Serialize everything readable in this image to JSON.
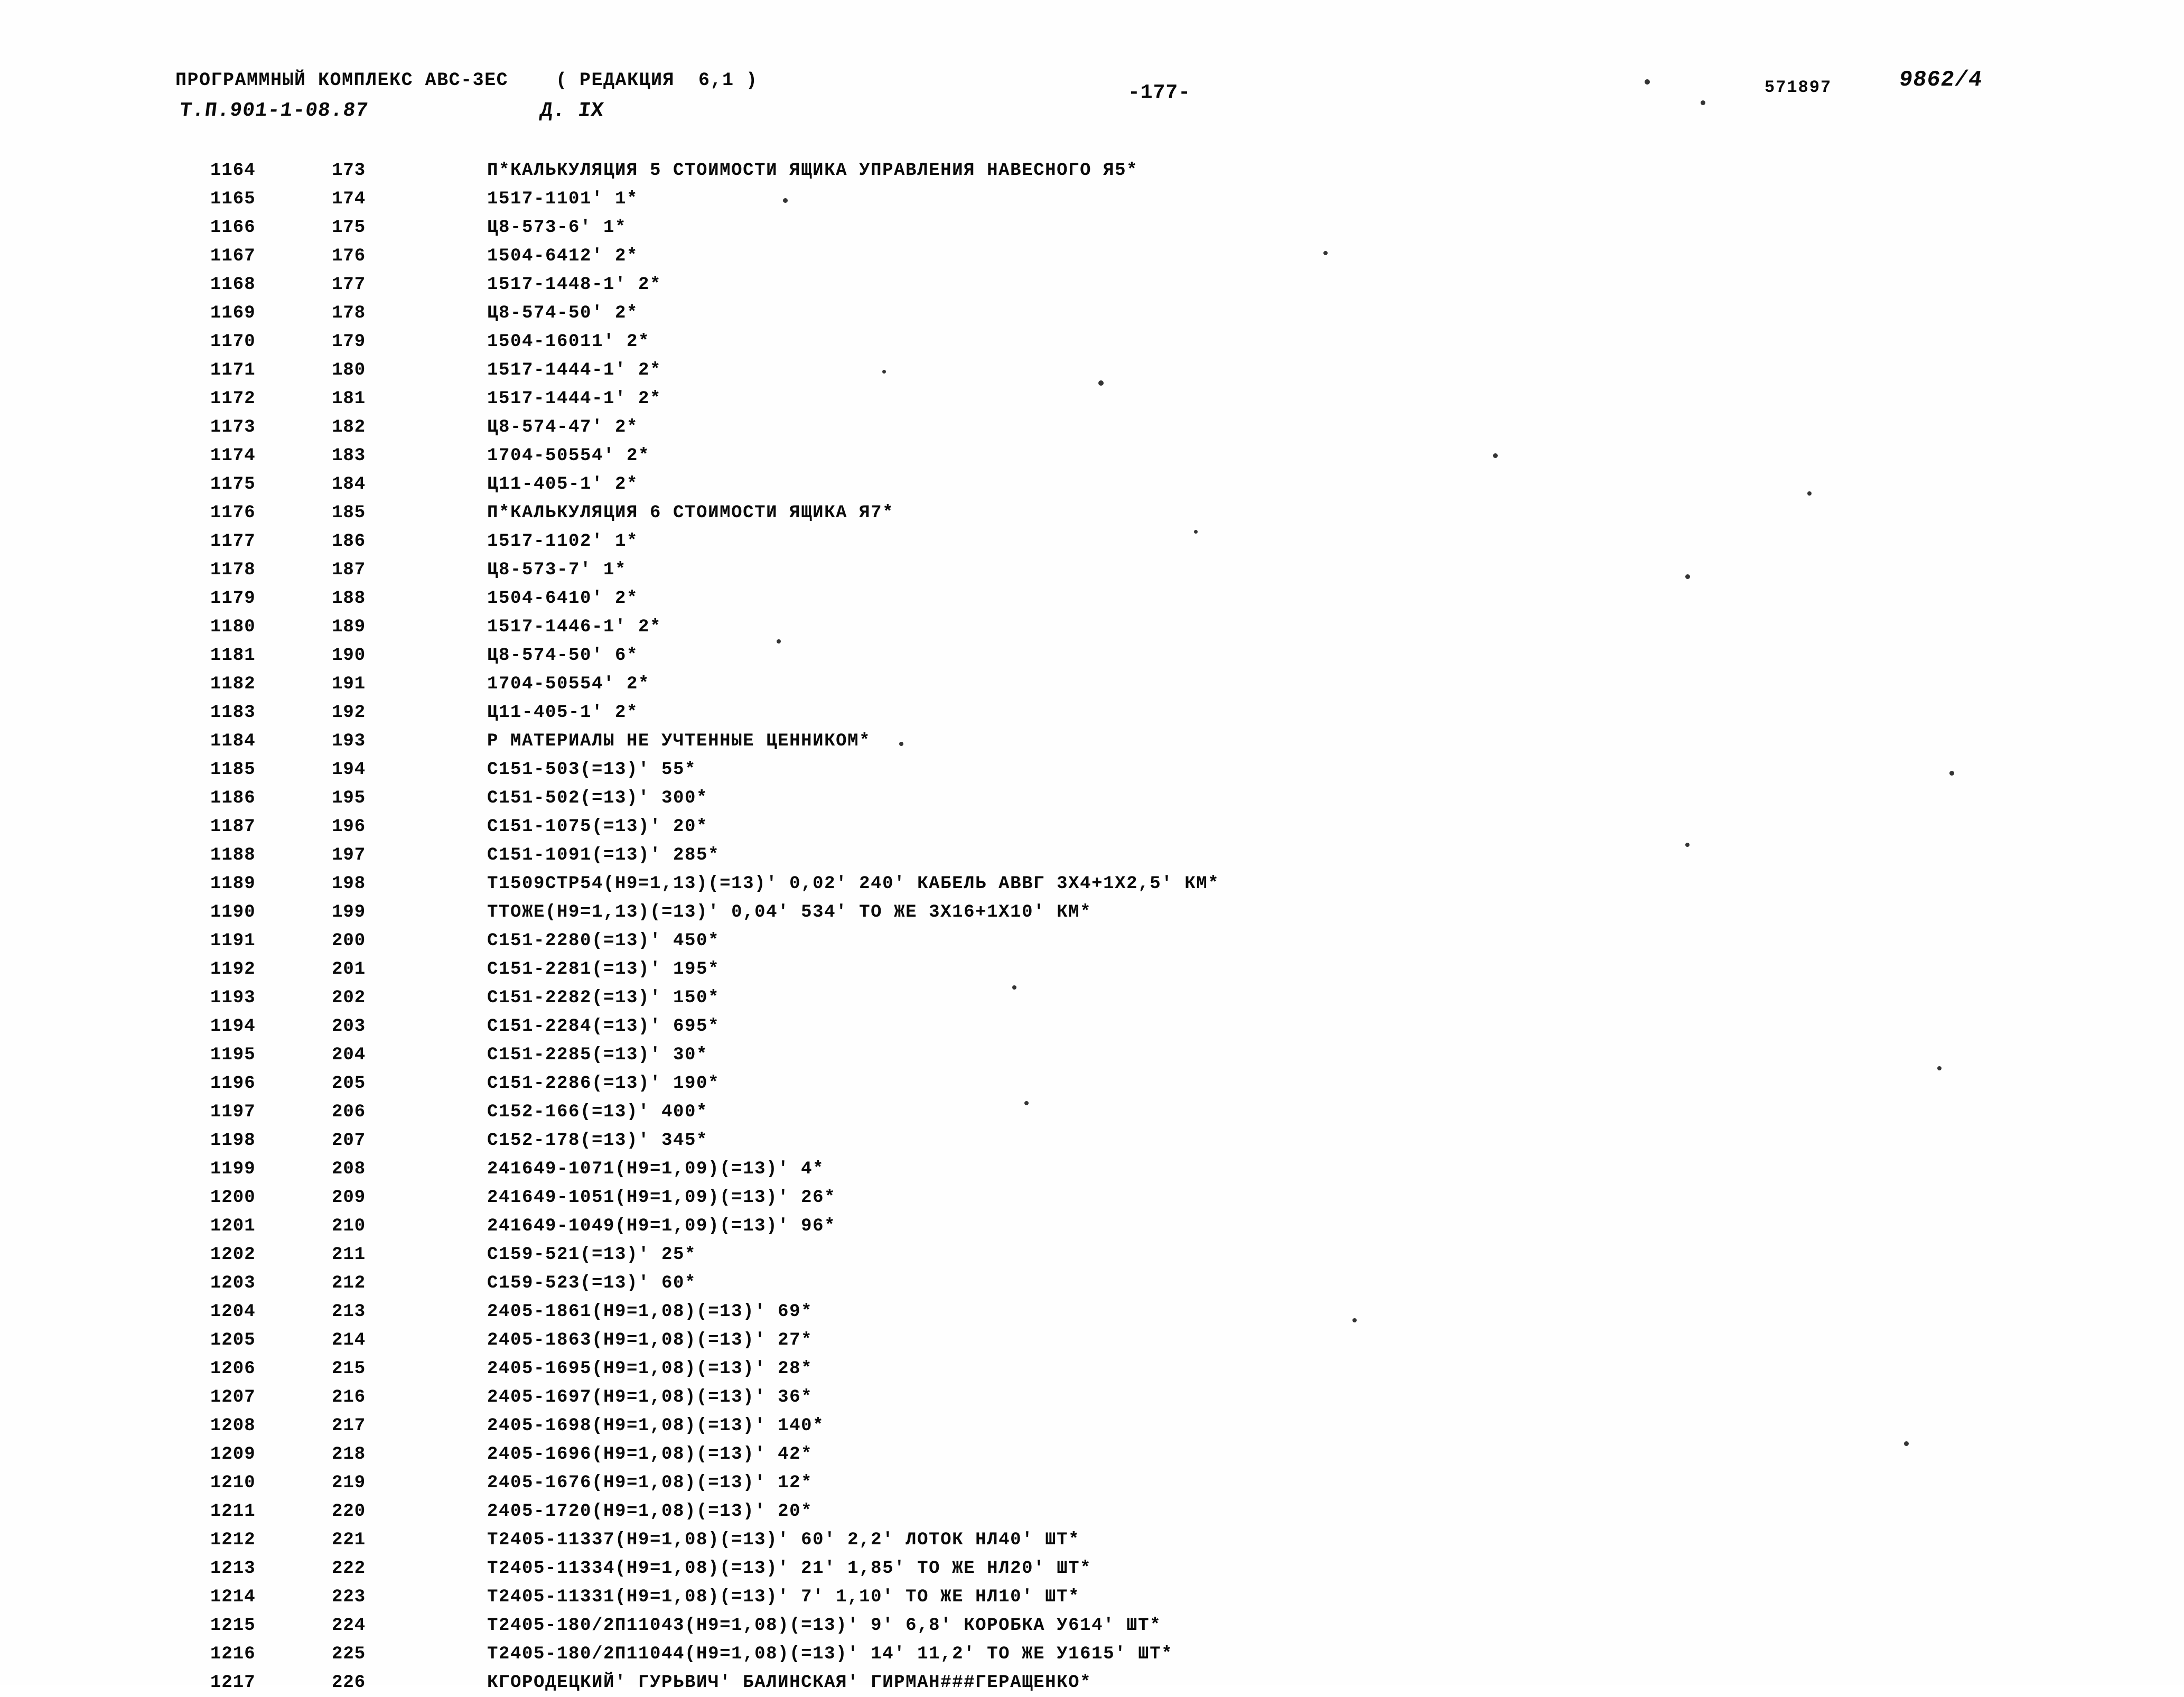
{
  "header": {
    "complex": "ПРОГРАММНЫЙ КОМПЛЕКС АВС-3ЕС",
    "edition": "( РЕДАКЦИЯ  6,1 )",
    "tp_code": "Т.П.901-1-08.87",
    "album": "Д. IX",
    "page_number": "-177-",
    "stamp_code": "571897",
    "doc_number": "9862/4"
  },
  "listing": {
    "rows": [
      {
        "seq": "1164",
        "num": "173",
        "text": "П*КАЛЬКУЛЯЦИЯ 5 СТОИМОСТИ ЯЩИКА УПРАВЛЕНИЯ НАВЕСНОГО Я5*"
      },
      {
        "seq": "1165",
        "num": "174",
        "text": "1517-1101' 1*"
      },
      {
        "seq": "1166",
        "num": "175",
        "text": "Ц8-573-6' 1*"
      },
      {
        "seq": "1167",
        "num": "176",
        "text": "1504-6412' 2*"
      },
      {
        "seq": "1168",
        "num": "177",
        "text": "1517-1448-1' 2*"
      },
      {
        "seq": "1169",
        "num": "178",
        "text": "Ц8-574-50' 2*"
      },
      {
        "seq": "1170",
        "num": "179",
        "text": "1504-16011' 2*"
      },
      {
        "seq": "1171",
        "num": "180",
        "text": "1517-1444-1' 2*"
      },
      {
        "seq": "1172",
        "num": "181",
        "text": "1517-1444-1' 2*"
      },
      {
        "seq": "1173",
        "num": "182",
        "text": "Ц8-574-47' 2*"
      },
      {
        "seq": "1174",
        "num": "183",
        "text": "1704-50554' 2*"
      },
      {
        "seq": "1175",
        "num": "184",
        "text": "Ц11-405-1' 2*"
      },
      {
        "seq": "1176",
        "num": "185",
        "text": "П*КАЛЬКУЛЯЦИЯ 6 СТОИМОСТИ ЯЩИКА Я7*"
      },
      {
        "seq": "1177",
        "num": "186",
        "text": "1517-1102' 1*"
      },
      {
        "seq": "1178",
        "num": "187",
        "text": "Ц8-573-7' 1*"
      },
      {
        "seq": "1179",
        "num": "188",
        "text": "1504-6410' 2*"
      },
      {
        "seq": "1180",
        "num": "189",
        "text": "1517-1446-1' 2*"
      },
      {
        "seq": "1181",
        "num": "190",
        "text": "Ц8-574-50' 6*"
      },
      {
        "seq": "1182",
        "num": "191",
        "text": "1704-50554' 2*"
      },
      {
        "seq": "1183",
        "num": "192",
        "text": "Ц11-405-1' 2*"
      },
      {
        "seq": "1184",
        "num": "193",
        "text": "Р МАТЕРИАЛЫ НЕ УЧТЕННЫЕ ЦЕННИКОМ*"
      },
      {
        "seq": "1185",
        "num": "194",
        "text": "С151-503(=13)' 55*"
      },
      {
        "seq": "1186",
        "num": "195",
        "text": "С151-502(=13)' 300*"
      },
      {
        "seq": "1187",
        "num": "196",
        "text": "С151-1075(=13)' 20*"
      },
      {
        "seq": "1188",
        "num": "197",
        "text": "С151-1091(=13)' 285*"
      },
      {
        "seq": "1189",
        "num": "198",
        "text": "Т1509СТР54(Н9=1,13)(=13)' 0,02' 240' КАБЕЛЬ АВВГ 3Х4+1Х2,5' КМ*"
      },
      {
        "seq": "1190",
        "num": "199",
        "text": "ТТОЖЕ(Н9=1,13)(=13)' 0,04' 534' ТО ЖЕ 3Х16+1Х10' КМ*"
      },
      {
        "seq": "1191",
        "num": "200",
        "text": "С151-2280(=13)' 450*"
      },
      {
        "seq": "1192",
        "num": "201",
        "text": "С151-2281(=13)' 195*"
      },
      {
        "seq": "1193",
        "num": "202",
        "text": "С151-2282(=13)' 150*"
      },
      {
        "seq": "1194",
        "num": "203",
        "text": "С151-2284(=13)' 695*"
      },
      {
        "seq": "1195",
        "num": "204",
        "text": "С151-2285(=13)' 30*"
      },
      {
        "seq": "1196",
        "num": "205",
        "text": "С151-2286(=13)' 190*"
      },
      {
        "seq": "1197",
        "num": "206",
        "text": "С152-166(=13)' 400*"
      },
      {
        "seq": "1198",
        "num": "207",
        "text": "С152-178(=13)' 345*"
      },
      {
        "seq": "1199",
        "num": "208",
        "text": "241649-1071(Н9=1,09)(=13)' 4*"
      },
      {
        "seq": "1200",
        "num": "209",
        "text": "241649-1051(Н9=1,09)(=13)' 26*"
      },
      {
        "seq": "1201",
        "num": "210",
        "text": "241649-1049(Н9=1,09)(=13)' 96*"
      },
      {
        "seq": "1202",
        "num": "211",
        "text": "С159-521(=13)' 25*"
      },
      {
        "seq": "1203",
        "num": "212",
        "text": "С159-523(=13)' 60*"
      },
      {
        "seq": "1204",
        "num": "213",
        "text": "2405-1861(Н9=1,08)(=13)' 69*"
      },
      {
        "seq": "1205",
        "num": "214",
        "text": "2405-1863(Н9=1,08)(=13)' 27*"
      },
      {
        "seq": "1206",
        "num": "215",
        "text": "2405-1695(Н9=1,08)(=13)' 28*"
      },
      {
        "seq": "1207",
        "num": "216",
        "text": "2405-1697(Н9=1,08)(=13)' 36*"
      },
      {
        "seq": "1208",
        "num": "217",
        "text": "2405-1698(Н9=1,08)(=13)' 140*"
      },
      {
        "seq": "1209",
        "num": "218",
        "text": "2405-1696(Н9=1,08)(=13)' 42*"
      },
      {
        "seq": "1210",
        "num": "219",
        "text": "2405-1676(Н9=1,08)(=13)' 12*"
      },
      {
        "seq": "1211",
        "num": "220",
        "text": "2405-1720(Н9=1,08)(=13)' 20*"
      },
      {
        "seq": "1212",
        "num": "221",
        "text": "Т2405-11337(Н9=1,08)(=13)' 60' 2,2' ЛОТОК НЛ40' ШТ*"
      },
      {
        "seq": "1213",
        "num": "222",
        "text": "Т2405-11334(Н9=1,08)(=13)' 21' 1,85' ТО ЖЕ НЛ20' ШТ*"
      },
      {
        "seq": "1214",
        "num": "223",
        "text": "Т2405-11331(Н9=1,08)(=13)' 7' 1,10' ТО ЖЕ НЛ10' ШТ*"
      },
      {
        "seq": "1215",
        "num": "224",
        "text": "Т2405-180/2П11043(Н9=1,08)(=13)' 9' 6,8' КОРОБКА У614' ШТ*"
      },
      {
        "seq": "1216",
        "num": "225",
        "text": "Т2405-180/2П11044(Н9=1,08)(=13)' 14' 11,2' ТО ЖЕ У1615' ШТ*"
      },
      {
        "seq": "1217",
        "num": "226",
        "text": "КГОРОДЕЦКИЙ' ГУРЬВИЧ' БАЛИНСКАЯ' ГИРМАН###ГЕРАЩЕНКО*"
      }
    ]
  }
}
